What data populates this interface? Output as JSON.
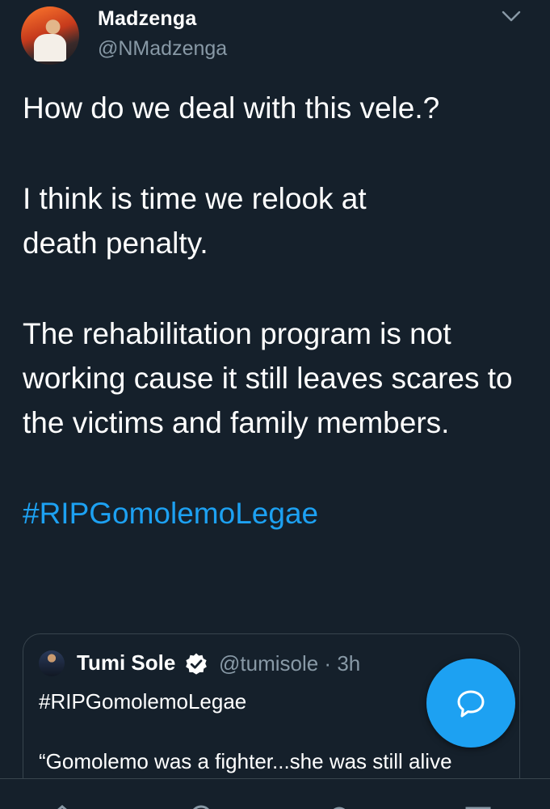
{
  "tweet": {
    "display_name": "Madzenga",
    "handle": "@NMadzenga",
    "paragraphs": [
      "How do we deal with this vele.?",
      "I think is time we relook at death penalty.",
      "The rehabilitation program is not working cause it still leaves scares to the victims and family members."
    ],
    "hashtag": "#RIPGomolemoLegae",
    "menu_icon": "chevron-down-icon"
  },
  "quoted_tweet": {
    "display_name": "Tumi Sole",
    "verified": true,
    "handle_time": "@tumisole · 3h",
    "hashtag": "#RIPGomolemoLegae",
    "text": "“Gomolemo was a fighter...she was still alive"
  },
  "compose_button": {
    "icon": "reply-bubble-icon"
  },
  "bottom_nav": {
    "items": [
      "home-icon",
      "search-icon",
      "notifications-icon",
      "messages-icon"
    ]
  },
  "colors": {
    "background": "#15202b",
    "accent": "#1da1f2",
    "secondary_text": "#8899a6",
    "border": "#38444d"
  }
}
